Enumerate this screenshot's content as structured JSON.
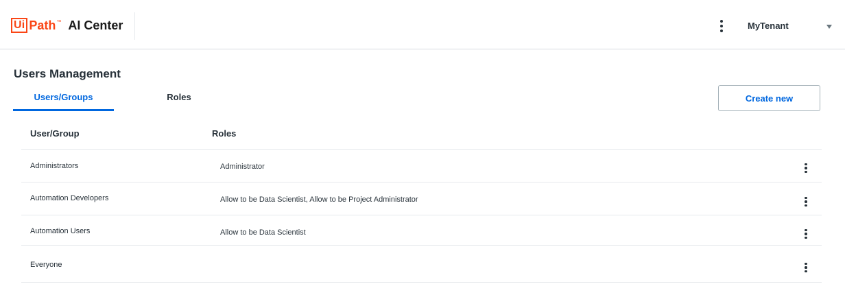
{
  "header": {
    "logo": {
      "ui": "Ui",
      "path": "Path",
      "tm": "™",
      "product": "AI Center"
    },
    "tenant": "MyTenant",
    "menu_icon": "kebab-vertical-icon",
    "caret_icon": "caret-down-icon"
  },
  "page": {
    "title": "Users Management"
  },
  "tabs": [
    {
      "label": "Users/Groups",
      "active": true
    },
    {
      "label": "Roles",
      "active": false
    }
  ],
  "actions": {
    "create_label": "Create new"
  },
  "table": {
    "columns": [
      "User/Group",
      "Roles"
    ],
    "rows": [
      {
        "user": "Administrators",
        "roles": "Administrator"
      },
      {
        "user": "Automation Developers",
        "roles": "Allow to be Data Scientist, Allow to be Project Administrator"
      },
      {
        "user": "Automation Users",
        "roles": "Allow to be Data Scientist"
      },
      {
        "user": "Everyone",
        "roles": ""
      }
    ],
    "row_menu_icon": "kebab-vertical-icon"
  },
  "colors": {
    "brand": "#fa4616",
    "accent": "#0067df",
    "text": "#273139",
    "divider": "#e6e9ec"
  }
}
